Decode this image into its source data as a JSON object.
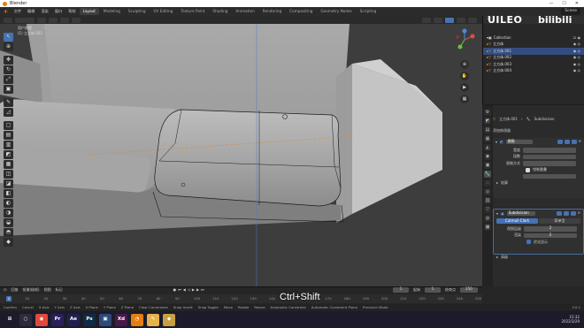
{
  "window": {
    "title": "Blender",
    "controls": [
      "—",
      "☐",
      "✕"
    ]
  },
  "menu": {
    "items": [
      "文件",
      "编辑",
      "渲染",
      "窗口",
      "帮助"
    ],
    "workspaces": [
      "Layout",
      "Modeling",
      "Sculpting",
      "UV Editing",
      "Texture Paint",
      "Shading",
      "Animation",
      "Rendering",
      "Compositing",
      "Geometry Nodes",
      "Scripting"
    ],
    "active_workspace": "Layout",
    "scene": "Scene",
    "view_layer": "ViewLayer"
  },
  "viewport": {
    "info_line1": "用户透视",
    "info_line2": "(1) 立方体.002"
  },
  "watermark": {
    "text": "UILEO",
    "text2": "bilibili"
  },
  "outliner": {
    "rows": [
      {
        "label": "Collection",
        "selected": false
      },
      {
        "label": "立方体",
        "selected": false
      },
      {
        "label": "立方体.001",
        "selected": true
      },
      {
        "label": "立方体.002",
        "selected": false
      },
      {
        "label": "立方体.003",
        "selected": false
      },
      {
        "label": "立方体.004",
        "selected": false
      }
    ]
  },
  "properties": {
    "breadcrumb_obj": "立方体.001",
    "breadcrumb_mod": "Subdivision",
    "add_modifier": "添加修改器",
    "mod1_name": "倒角",
    "mod1_fields": [
      "宽度",
      "段数",
      "限制方式"
    ],
    "mod1_toggle": "钳制重叠",
    "mod2_name": "Subdivision",
    "mod2_tab1": "Catmull-Clark",
    "mod2_tab2": "简单型",
    "mod2_row1": "视图层级",
    "mod2_row1_val": "2",
    "mod2_row2": "渲染",
    "mod2_row2_val": "2",
    "mod2_check": "优化显示",
    "mod2_adv": "高级",
    "mod1_adv": "轮廓"
  },
  "timeline": {
    "playback": "回放",
    "keying": "抠像(插帧)",
    "view": "视图",
    "marker": "标记",
    "current_frame": "1",
    "start_label": "起始",
    "start": "1",
    "end_label": "结束点",
    "end": "250",
    "ruler": [
      "0",
      "10",
      "20",
      "30",
      "40",
      "50",
      "60",
      "70",
      "80",
      "90",
      "100",
      "110",
      "120",
      "130",
      "140",
      "150",
      "160",
      "170",
      "180",
      "190",
      "200",
      "210",
      "220",
      "230",
      "240",
      "250"
    ]
  },
  "keyboard_hint": "Ctrl+Shift",
  "statusbar": {
    "items": [
      "Confirm",
      "Cancel",
      "X Axis",
      "Y Axis",
      "Z Axis",
      "X Plane",
      "Y Plane",
      "Z Plane",
      "Clear Constraints",
      "Snap Invert",
      "Snap Toggle",
      "Move",
      "Rotate",
      "Resize",
      "Automatic Constraint",
      "Automatic Constraint Plane",
      "Precision Mode"
    ],
    "version": "3.0.1"
  },
  "taskbar": {
    "apps": [
      {
        "label": "⊞",
        "color": "#1b1b2b"
      },
      {
        "label": "○",
        "color": "#2b2b3b"
      },
      {
        "label": "◉",
        "color": "#e04a3a"
      },
      {
        "label": "Pr",
        "color": "#2a1f5c"
      },
      {
        "label": "Ae",
        "color": "#20204f"
      },
      {
        "label": "Ps",
        "color": "#0f2a45"
      },
      {
        "label": "▣",
        "color": "#2d4a78"
      },
      {
        "label": "Xd",
        "color": "#4a1848"
      },
      {
        "label": "◔",
        "color": "#e87d0d"
      },
      {
        "label": "✎",
        "color": "#e8b24a"
      },
      {
        "label": "◆",
        "color": "#c8a040"
      }
    ],
    "time": "15:32",
    "date": "2022/3/29"
  },
  "colors": {
    "accent": "#4772b3",
    "blender_orange": "#e87d0d",
    "viewport_bg": "#3d3d3d"
  }
}
